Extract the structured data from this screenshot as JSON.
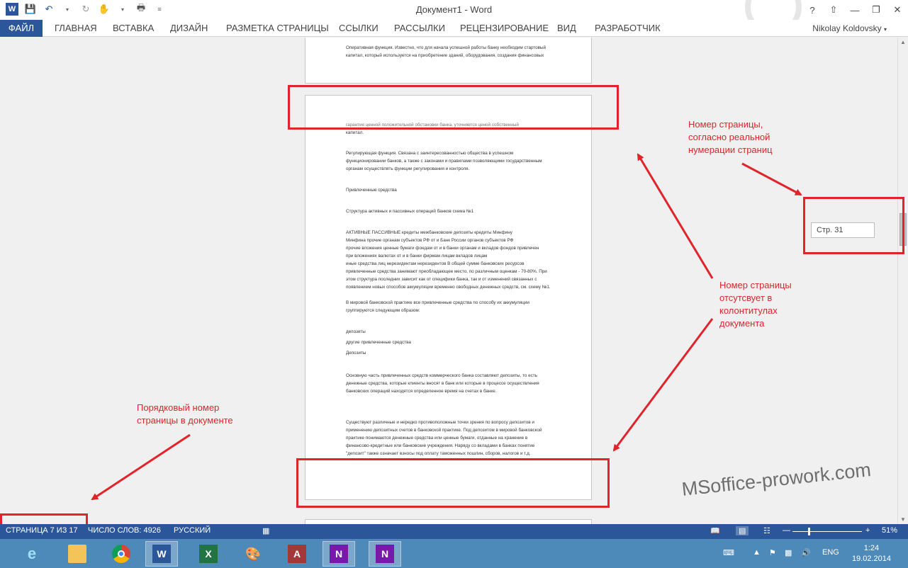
{
  "window": {
    "title": "Документ1 - Word",
    "help": "?",
    "user": "Nikolay Koldovsky"
  },
  "ribbon": {
    "tabs": [
      "ФАЙЛ",
      "ГЛАВНАЯ",
      "ВСТАВКА",
      "ДИЗАЙН",
      "РАЗМЕТКА СТРАНИЦЫ",
      "ССЫЛКИ",
      "РАССЫЛКИ",
      "РЕЦЕНЗИРОВАНИЕ",
      "ВИД",
      "РАЗРАБОТЧИК"
    ]
  },
  "document": {
    "page1": [
      "Оперативная функция. Известно, что для начала успешной работы банку необходим стартовый",
      "капитал, который используется на приобретение зданий, оборудования, создания финансовых"
    ],
    "page2": [
      "гарантия ценной положительной обстановки банка, уточняется ценой собственный",
      "капитал.",
      "Регулирующая функция. Связана с заинтересованностью общества в успешном",
      "функционировании банков, а также с законами и правилами позволяющими государственным",
      "органам осуществлять функции регулирования и контроля.",
      "Привлеченные средства",
      "Структура активных и пассивных операций банков схема №1",
      "АКТИВНЫЕ ПАССИВНЫЕ кредиты межбанковские депозиты кредиты Минфину",
      "Минфина прочие органам субъектов РФ от и Банк России органов субъектов РФ",
      "прочие вложения ценные бумаги фондам от и в банки органам и вкладов фондов привлечен",
      "при вложениях валютах от и в банки фирмам лицам вкладов лицам",
      "иные средства лиц нерезидентам нерезидентов В общей сумме банковских ресурсов",
      "привлеченные средства занимают преобладающее место, по различным оценкам - 70-80%. При",
      "этом структура последних зависит как от специфики банка, так и от изменений связанных с",
      "появлением новых способов аккумуляции временно свободных денежных средств, см. схему №1.",
      "В мировой банковской практике все привлеченные средства по способу их аккумуляции",
      "группируются следующим образом:",
      "депозиты",
      "другие привлеченные средства",
      "Депозиты",
      "Основную часть привлеченных средств коммерческого банка составляют депозиты, то есть",
      "денежные средства, которые клиенты вносят в банк или которые в процессе осуществления",
      "банковских операций находятся определенное время на счетах в банке.",
      "Существуют различные и нередко противоположные точки зрения по вопросу депозитов и",
      "применению депозитных счетов в банковской практике. Под депозитом в мировой банковской",
      "практике понимаются денежные средства или ценные бумаги, отданные на хранение в",
      "финансово-кредитные или банковские учреждения. Наряду со вкладами в банках понятие",
      "\"депозит\" также означает взносы под оплату таможенных пошлин, сборов, налогов и т.д."
    ]
  },
  "tooltip": {
    "page_label": "Стр. 31"
  },
  "annotations": {
    "note_top": [
      "Номер страницы,",
      "согласно реальной",
      "нумерации страниц"
    ],
    "note_mid": [
      "Номер страницы",
      "отсутсвует в",
      "колонтитулах",
      "документа"
    ],
    "note_left": [
      "Порядковый номер",
      "страницы в документе"
    ],
    "brand": "MSoffice-prowork.com"
  },
  "statusbar": {
    "page": "СТРАНИЦА 7 ИЗ 17",
    "words": "ЧИСЛО СЛОВ: 4926",
    "language": "РУССКИЙ",
    "zoom": "51%",
    "zoom_level": 0.51
  },
  "taskbar": {
    "lang": "ENG",
    "time": "1:24",
    "date": "19.02.2014"
  },
  "colors": {
    "accent": "#2b579a",
    "annotation": "#e0242b",
    "taskbar": "#4e8ab9"
  }
}
